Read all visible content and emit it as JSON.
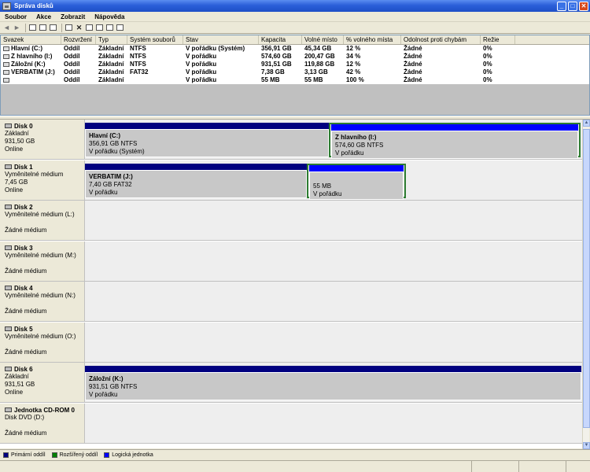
{
  "window": {
    "title": "Správa disků"
  },
  "menu": [
    "Soubor",
    "Akce",
    "Zobrazit",
    "Nápověda"
  ],
  "volume_list": {
    "columns": [
      "Svazek",
      "Rozvržení",
      "Typ",
      "Systém souborů",
      "Stav",
      "Kapacita",
      "Volné místo",
      "% volného místa",
      "Odolnost proti chybám",
      "Režie"
    ],
    "rows": [
      [
        "Hlavní (C:)",
        "Oddíl",
        "Základní",
        "NTFS",
        "V pořádku (Systém)",
        "356,91 GB",
        "45,34 GB",
        "12 %",
        "Žádné",
        "0%"
      ],
      [
        "Z hlavního (I:)",
        "Oddíl",
        "Základní",
        "NTFS",
        "V pořádku",
        "574,60 GB",
        "200,47 GB",
        "34 %",
        "Žádné",
        "0%"
      ],
      [
        "Záložní (K:)",
        "Oddíl",
        "Základní",
        "NTFS",
        "V pořádku",
        "931,51 GB",
        "119,88 GB",
        "12 %",
        "Žádné",
        "0%"
      ],
      [
        "VERBATIM (J:)",
        "Oddíl",
        "Základní",
        "FAT32",
        "V pořádku",
        "7,38 GB",
        "3,13 GB",
        "42 %",
        "Žádné",
        "0%"
      ],
      [
        "",
        "Oddíl",
        "Základní",
        "",
        "V pořádku",
        "55 MB",
        "55 MB",
        "100 %",
        "Žádné",
        "0%"
      ]
    ]
  },
  "disks": [
    {
      "name": "Disk 0",
      "lines": [
        "Základní",
        "931,50 GB",
        "Online"
      ],
      "partitions": [
        {
          "name": "Hlavní (C:)",
          "lines": [
            "356,91 GB NTFS",
            "V pořádku (Systém)"
          ],
          "kind": "primary",
          "selected": false
        },
        {
          "name": "Z hlavního (I:)",
          "lines": [
            "574,60 GB NTFS",
            "V pořádku"
          ],
          "kind": "logical",
          "selected": true
        }
      ]
    },
    {
      "name": "Disk 1",
      "lines": [
        "Vyměnitelné médium",
        "7,45 GB",
        "Online"
      ],
      "partitions": [
        {
          "name": "VERBATIM (J:)",
          "lines": [
            "7,40 GB FAT32",
            "V pořádku"
          ],
          "kind": "primary",
          "selected": false
        },
        {
          "name": "",
          "lines": [
            "55 MB",
            "V pořádku"
          ],
          "kind": "logical",
          "selected": true
        }
      ]
    },
    {
      "name": "Disk 2",
      "lines": [
        "Vyměnitelné médium (L:)",
        "",
        "Žádné médium"
      ],
      "partitions": []
    },
    {
      "name": "Disk 3",
      "lines": [
        "Vyměnitelné médium (M:)",
        "",
        "Žádné médium"
      ],
      "partitions": []
    },
    {
      "name": "Disk 4",
      "lines": [
        "Vyměnitelné médium (N:)",
        "",
        "Žádné médium"
      ],
      "partitions": []
    },
    {
      "name": "Disk 5",
      "lines": [
        "Vyměnitelné médium (O:)",
        "",
        "Žádné médium"
      ],
      "partitions": []
    },
    {
      "name": "Disk 6",
      "lines": [
        "Základní",
        "931,51 GB",
        "Online"
      ],
      "partitions": [
        {
          "name": "Záložní (K:)",
          "lines": [
            "931,51 GB NTFS",
            "V pořádku"
          ],
          "kind": "primary",
          "selected": false
        }
      ]
    },
    {
      "name": "Jednotka CD-ROM 0",
      "lines": [
        "Disk DVD (D:)",
        "",
        "Žádné médium"
      ],
      "partitions": []
    }
  ],
  "legend": [
    {
      "label": "Primární oddíl",
      "color": "#00007f"
    },
    {
      "label": "Rozšířený oddíl",
      "color": "#008000"
    },
    {
      "label": "Logická jednotka",
      "color": "#0000ff"
    }
  ],
  "colors": {
    "primary_bar": "#00007f",
    "logical_bar": "#0000ff",
    "selection": "#2e7d32"
  }
}
